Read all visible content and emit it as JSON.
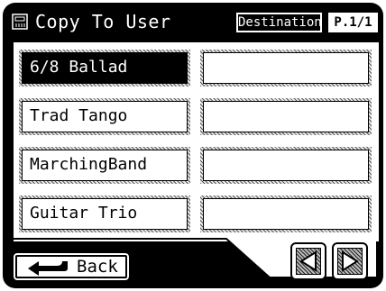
{
  "header": {
    "icon": "keyboard-icon",
    "title": "Copy To User",
    "destination_label": "Destination",
    "page_indicator": "P.1/1"
  },
  "slots": [
    {
      "label": "6/8 Ballad",
      "selected": true
    },
    {
      "label": "Trad Tango",
      "selected": false
    },
    {
      "label": "MarchingBand",
      "selected": false
    },
    {
      "label": "Guitar Trio",
      "selected": false
    },
    {
      "label": "",
      "selected": false
    },
    {
      "label": "",
      "selected": false
    },
    {
      "label": "",
      "selected": false
    },
    {
      "label": "",
      "selected": false
    }
  ],
  "footer": {
    "back_label": "Back",
    "back_icon": "return-arrow-icon",
    "prev_icon": "triangle-left-icon",
    "next_icon": "triangle-right-icon"
  }
}
